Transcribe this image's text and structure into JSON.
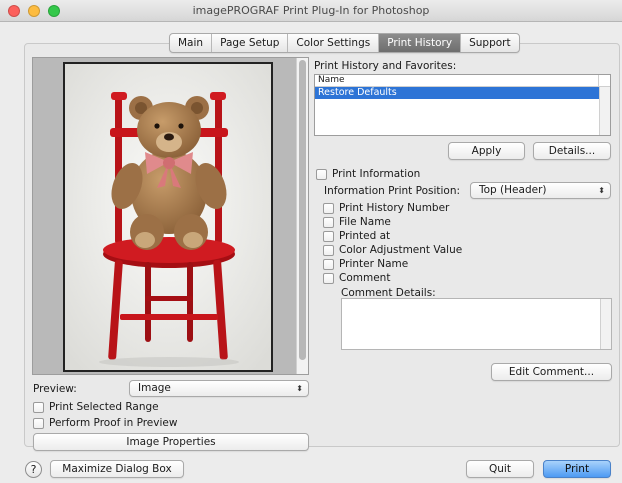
{
  "window": {
    "title": "imagePROGRAF Print Plug-In for Photoshop",
    "traffic_colors": [
      "#fc605c",
      "#fdbc40",
      "#34c84a"
    ]
  },
  "tabs": [
    {
      "label": "Main",
      "active": false
    },
    {
      "label": "Page Setup",
      "active": false
    },
    {
      "label": "Color Settings",
      "active": false
    },
    {
      "label": "Print History",
      "active": true
    },
    {
      "label": "Support",
      "active": false
    }
  ],
  "preview": {
    "label": "Preview:",
    "mode_value": "Image",
    "print_selected_range": "Print Selected Range",
    "perform_proof": "Perform Proof in Preview",
    "image_properties_button": "Image Properties"
  },
  "history": {
    "title": "Print History and Favorites:",
    "column_header": "Name",
    "items": [
      "Restore Defaults"
    ],
    "apply_button": "Apply",
    "details_button": "Details..."
  },
  "print_info": {
    "checkbox_label": "Print Information",
    "position_label": "Information Print Position:",
    "position_value": "Top (Header)",
    "options": [
      "Print History Number",
      "File Name",
      "Printed at",
      "Color Adjustment Value",
      "Printer Name",
      "Comment"
    ],
    "comment_details_label": "Comment Details:",
    "edit_comment_button": "Edit Comment..."
  },
  "footer": {
    "help_glyph": "?",
    "maximize_button": "Maximize Dialog Box",
    "quit_button": "Quit",
    "print_button": "Print"
  },
  "colors": {
    "accent_blue": "#2d74d6",
    "chair_red": "#c8151b",
    "bear_brown": "#a67a4c",
    "bow_pink": "#e08a8c"
  }
}
